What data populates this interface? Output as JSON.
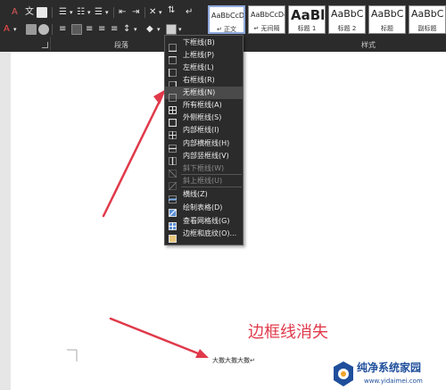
{
  "ribbon": {
    "groups": {
      "paragraph_label": "段落",
      "styles_label": "样式"
    },
    "style_gallery": [
      {
        "sample": "AaBbCcDd",
        "name": "正文",
        "prefix": "↵",
        "selected": true
      },
      {
        "sample": "AaBbCcDd",
        "name": "无间隔",
        "prefix": "↵",
        "selected": false
      },
      {
        "sample": "AaBl",
        "name": "标题 1",
        "prefix": "",
        "selected": false
      },
      {
        "sample": "AaBbC",
        "name": "标题 2",
        "prefix": "",
        "selected": false
      },
      {
        "sample": "AaBbC",
        "name": "标题",
        "prefix": "",
        "selected": false
      },
      {
        "sample": "AaBbC",
        "name": "副标题",
        "prefix": "",
        "selected": false
      }
    ]
  },
  "border_menu": {
    "items": [
      {
        "label": "下框线(B)",
        "icon": "bottom-border-icon",
        "disabled": false
      },
      {
        "label": "上框线(P)",
        "icon": "top-border-icon",
        "disabled": false
      },
      {
        "label": "左框线(L)",
        "icon": "left-border-icon",
        "disabled": false
      },
      {
        "label": "右框线(R)",
        "icon": "right-border-icon",
        "disabled": false
      },
      {
        "label": "无框线(N)",
        "icon": "no-border-icon",
        "disabled": false,
        "hover": true
      },
      {
        "label": "所有框线(A)",
        "icon": "all-borders-icon",
        "disabled": false
      },
      {
        "label": "外侧框线(S)",
        "icon": "outside-borders-icon",
        "disabled": false
      },
      {
        "label": "内部框线(I)",
        "icon": "inside-borders-icon",
        "disabled": false
      },
      {
        "label": "内部横框线(H)",
        "icon": "inside-horizontal-border-icon",
        "disabled": false
      },
      {
        "label": "内部竖框线(V)",
        "icon": "inside-vertical-border-icon",
        "disabled": false
      },
      {
        "label": "斜下框线(W)",
        "icon": "diagonal-down-border-icon",
        "disabled": true
      },
      {
        "label": "斜上框线(U)",
        "icon": "diagonal-up-border-icon",
        "disabled": true
      },
      {
        "label": "横线(Z)",
        "icon": "horizontal-line-icon",
        "disabled": false
      },
      {
        "label": "绘制表格(D)",
        "icon": "draw-table-icon",
        "disabled": false
      },
      {
        "label": "查看网格线(G)",
        "icon": "view-gridlines-icon",
        "disabled": false
      },
      {
        "label": "边框和底纹(O)...",
        "icon": "borders-shading-icon",
        "disabled": false
      }
    ]
  },
  "document": {
    "annotation": "边框线消失",
    "body_text": "大撒大撒大撒↵"
  },
  "watermark": {
    "name": "纯净系统家园",
    "url": "www.yidaimei.com"
  },
  "colors": {
    "ribbon_bg": "#2b2b2b",
    "menu_bg": "#2b2b2b",
    "menu_hover": "#4a4a4a",
    "arrow_red": "#e0394a",
    "watermark_blue": "#1f4f9c"
  }
}
